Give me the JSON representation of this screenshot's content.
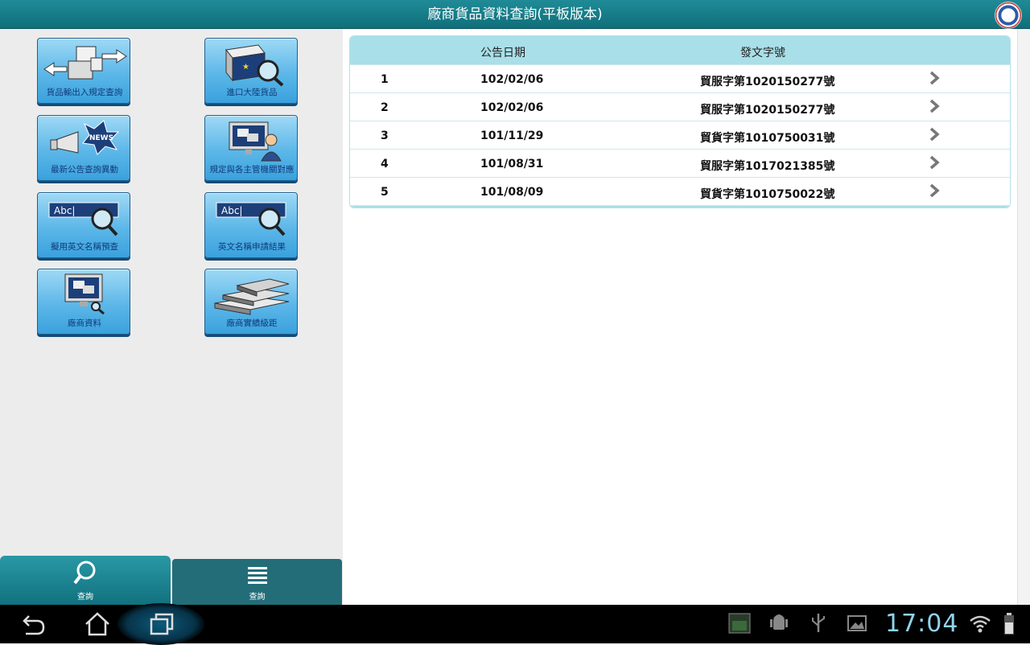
{
  "app": {
    "title": "廠商貨品資料查詢(平板版本)"
  },
  "tiles": [
    {
      "label": "貨品輸出入規定查詢",
      "icon": "boxes-arrows-icon"
    },
    {
      "label": "進口大陸貨品",
      "icon": "china-box-search-icon"
    },
    {
      "label": "最新公告查詢異動",
      "icon": "news-megaphone-icon"
    },
    {
      "label": "規定與各主管機關對應",
      "icon": "monitor-person-icon"
    },
    {
      "label": "擬用英文名稱預查",
      "icon": "abc-search-icon"
    },
    {
      "label": "英文名稱申請結果",
      "icon": "abc-search-icon"
    },
    {
      "label": "廠商資料",
      "icon": "monitor-search-icon"
    },
    {
      "label": "廠商實績級距",
      "icon": "stacked-books-icon"
    }
  ],
  "tabs": [
    {
      "label": "查詢",
      "icon": "search-icon"
    },
    {
      "label": "查詢",
      "icon": "list-icon"
    }
  ],
  "table": {
    "headers": {
      "date": "公告日期",
      "doc": "發文字號"
    },
    "rows": [
      {
        "num": "1",
        "date": "102/02/06",
        "doc": "貿服字第1020150277號"
      },
      {
        "num": "2",
        "date": "102/02/06",
        "doc": "貿服字第1020150277號"
      },
      {
        "num": "3",
        "date": "101/11/29",
        "doc": "貿貨字第1010750031號"
      },
      {
        "num": "4",
        "date": "101/08/31",
        "doc": "貿服字第1017021385號"
      },
      {
        "num": "5",
        "date": "101/08/09",
        "doc": "貿貨字第1010750022號"
      }
    ]
  },
  "system": {
    "clock": "17:04"
  },
  "colors": {
    "header": "#1f8b97",
    "tile": "#5cb7e8",
    "table_header": "#a9dfe8",
    "clock": "#8fd4f0"
  }
}
